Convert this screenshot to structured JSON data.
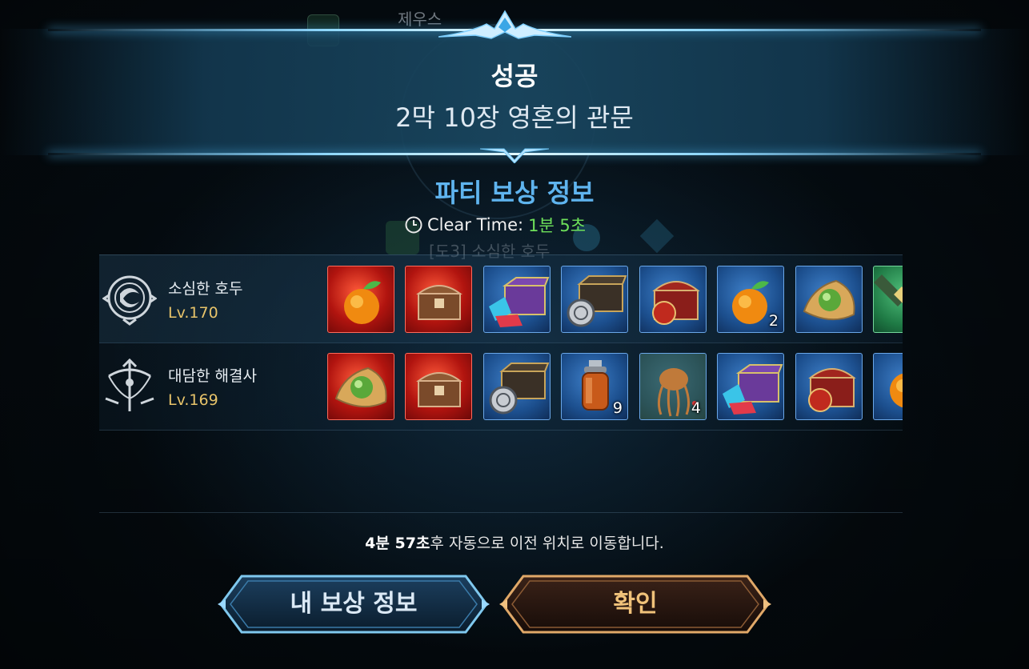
{
  "background": {
    "player_name": "제우스",
    "behind_text": "[도3] 소심한 호두"
  },
  "header": {
    "result": "성공",
    "stage": "2막 10장 영혼의 관문"
  },
  "rewards": {
    "title": "파티 보상 정보",
    "clear_time_label": "Clear Time:",
    "clear_time_value": "1분 5초",
    "players": [
      {
        "name": "소심한 호두",
        "level": "Lv.170",
        "class_icon": "sorcerer-emblem-icon",
        "items": [
          {
            "icon": "orange-fruit-icon",
            "rarity": "red",
            "count": ""
          },
          {
            "icon": "wooden-chest-icon",
            "rarity": "red",
            "count": ""
          },
          {
            "icon": "purple-gem-chest-icon",
            "rarity": "blue",
            "count": ""
          },
          {
            "icon": "silver-coin-chest-icon",
            "rarity": "blue",
            "count": ""
          },
          {
            "icon": "red-treasure-chest-icon",
            "rarity": "blue",
            "count": ""
          },
          {
            "icon": "orange-fruit-icon",
            "rarity": "blue",
            "count": "2"
          },
          {
            "icon": "green-orb-pouch-icon",
            "rarity": "blue",
            "count": ""
          },
          {
            "icon": "green-scroll-icon",
            "rarity": "green",
            "count": ""
          }
        ]
      },
      {
        "name": "대담한 해결사",
        "level": "Lv.169",
        "class_icon": "crossbow-emblem-icon",
        "items": [
          {
            "icon": "green-orb-pouch-icon",
            "rarity": "red",
            "count": ""
          },
          {
            "icon": "wooden-chest-icon",
            "rarity": "red",
            "count": ""
          },
          {
            "icon": "silver-coin-chest-icon",
            "rarity": "blue",
            "count": ""
          },
          {
            "icon": "lantern-bottle-icon",
            "rarity": "blue",
            "count": "9"
          },
          {
            "icon": "jellyfish-herb-icon",
            "rarity": "blue",
            "count": "4"
          },
          {
            "icon": "purple-gem-chest-icon",
            "rarity": "blue",
            "count": ""
          },
          {
            "icon": "red-treasure-chest-icon",
            "rarity": "blue",
            "count": ""
          },
          {
            "icon": "orange-fruit-icon",
            "rarity": "blue",
            "count": ""
          }
        ]
      }
    ]
  },
  "footer": {
    "countdown": "4분 57초",
    "notice_rest": "후 자동으로 이전 위치로 이동합니다.",
    "my_rewards_button": "내 보상 정보",
    "confirm_button": "확인"
  },
  "colors": {
    "accent_blue": "#5fb4ef",
    "clear_time_green": "#6ee05a",
    "level_gold": "#e8c46a",
    "confirm_gold": "#f0c27a"
  }
}
